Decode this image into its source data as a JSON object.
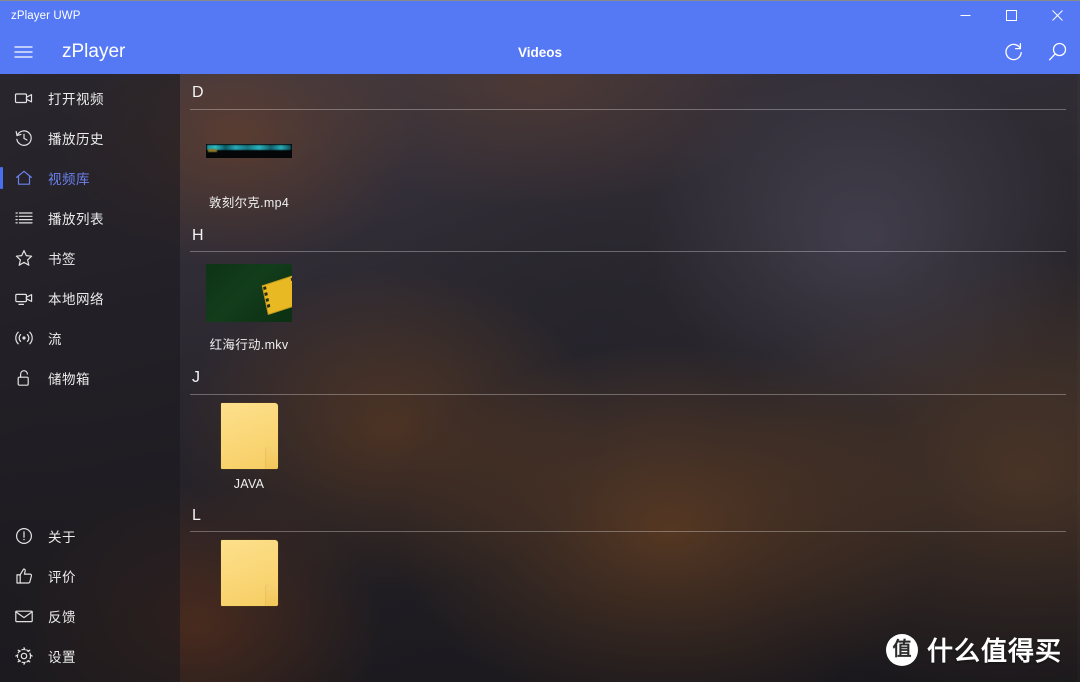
{
  "window": {
    "title": "zPlayer UWP",
    "minimize_label": "─",
    "maximize_label": "□",
    "close_label": "×",
    "accent_color": "#5578f5",
    "selection_color": "#4a6ef0"
  },
  "header": {
    "app_name": "zPlayer",
    "page_title": "Videos",
    "menu_icon": "hamburger-icon",
    "refresh_icon": "refresh-icon",
    "search_icon": "search-icon"
  },
  "sidebar": {
    "top_items": [
      {
        "label": "打开视频",
        "icon": "video-camera-icon",
        "selected": false
      },
      {
        "label": "播放历史",
        "icon": "history-clock-icon",
        "selected": false
      },
      {
        "label": "视频库",
        "icon": "home-icon",
        "selected": true
      },
      {
        "label": "播放列表",
        "icon": "list-icon",
        "selected": false
      },
      {
        "label": "书签",
        "icon": "star-icon",
        "selected": false
      },
      {
        "label": "本地网络",
        "icon": "network-device-icon",
        "selected": false
      },
      {
        "label": "流",
        "icon": "broadcast-icon",
        "selected": false
      },
      {
        "label": "储物箱",
        "icon": "unlocked-padlock-icon",
        "selected": false
      }
    ],
    "bottom_items": [
      {
        "label": "关于",
        "icon": "info-circle-icon",
        "selected": false
      },
      {
        "label": "评价",
        "icon": "thumbs-up-icon",
        "selected": false
      },
      {
        "label": "反馈",
        "icon": "envelope-icon",
        "selected": false
      },
      {
        "label": "设置",
        "icon": "gear-icon",
        "selected": false
      }
    ]
  },
  "content": {
    "groups": [
      {
        "letter": "D",
        "items": [
          {
            "name": "敦刻尔克.mp4",
            "kind": "video-strip"
          }
        ]
      },
      {
        "letter": "H",
        "items": [
          {
            "name": "红海行动.mkv",
            "kind": "video-thumb"
          }
        ]
      },
      {
        "letter": "J",
        "items": [
          {
            "name": "JAVA",
            "kind": "folder"
          }
        ]
      },
      {
        "letter": "L",
        "items": [
          {
            "name": "",
            "kind": "folder"
          }
        ]
      }
    ]
  },
  "watermark": {
    "logo_char": "值",
    "text": "什么值得买"
  }
}
